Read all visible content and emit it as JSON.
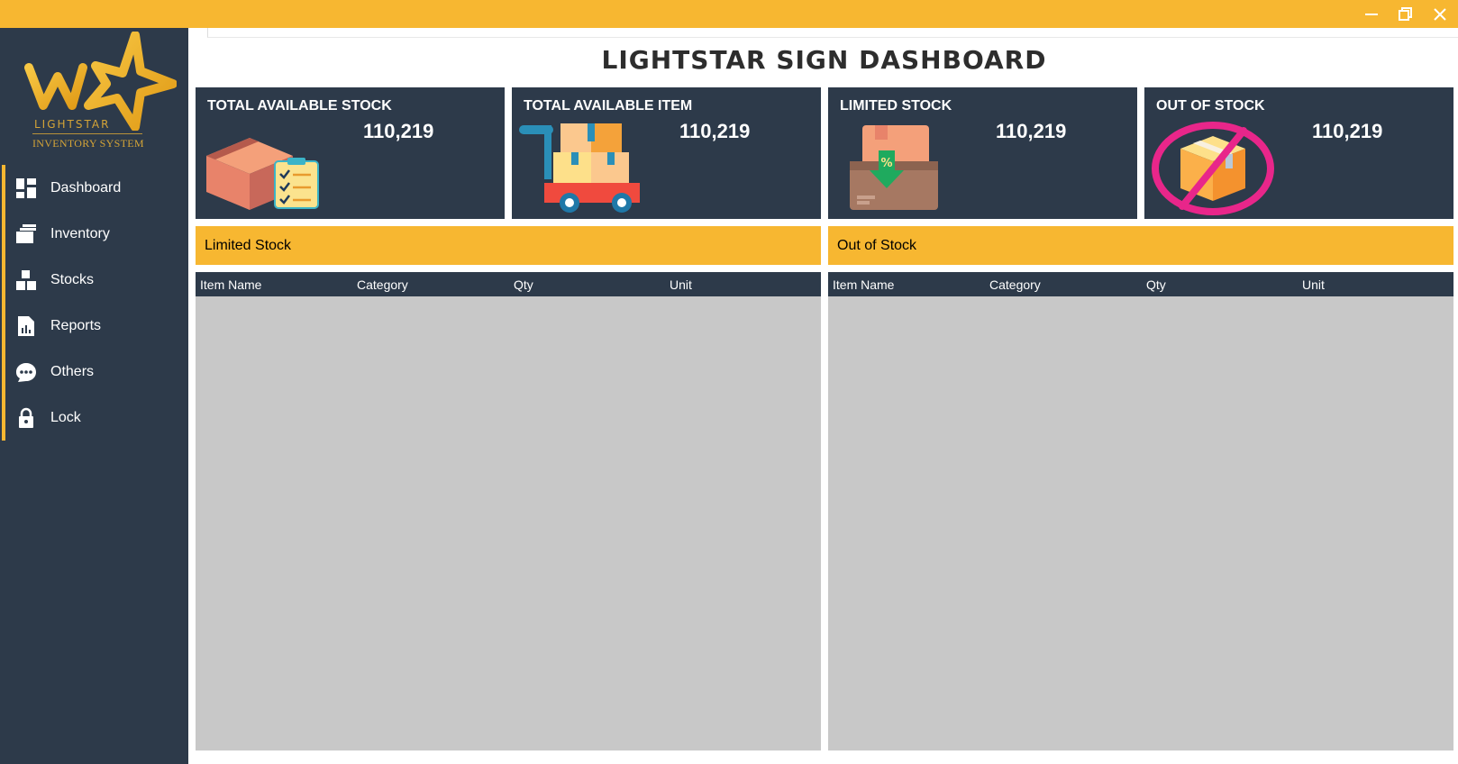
{
  "window": {
    "minimize_icon": "minimize-icon",
    "maximize_icon": "restore-icon",
    "close_icon": "close-icon",
    "accent_color": "#f7b731"
  },
  "logo": {
    "line1": "LIGHTSTAR",
    "line2": "INVENTORY SYSTEM"
  },
  "sidebar": {
    "background": "#2d3a4a",
    "items": [
      {
        "label": "Dashboard",
        "icon": "dashboard-icon"
      },
      {
        "label": "Inventory",
        "icon": "inventory-icon"
      },
      {
        "label": "Stocks",
        "icon": "stocks-icon"
      },
      {
        "label": "Reports",
        "icon": "reports-icon"
      },
      {
        "label": "Others",
        "icon": "others-icon"
      },
      {
        "label": "Lock",
        "icon": "lock-icon"
      }
    ]
  },
  "page": {
    "title": "LIGHTSTAR SIGN DASHBOARD"
  },
  "cards": [
    {
      "title": "TOTAL AVAILABLE STOCK",
      "value": "110,219",
      "icon": "box-checklist-icon"
    },
    {
      "title": "TOTAL AVAILABLE ITEM",
      "value": "110,219",
      "icon": "cart-boxes-icon"
    },
    {
      "title": "LIMITED STOCK",
      "value": "110,219",
      "icon": "box-discount-icon"
    },
    {
      "title": "OUT OF STOCK",
      "value": "110,219",
      "icon": "no-box-icon"
    }
  ],
  "panels": [
    {
      "header": "Limited Stock",
      "columns": [
        "Item Name",
        "Category",
        "Qty",
        "Unit"
      ]
    },
    {
      "header": "Out of Stock",
      "columns": [
        "Item Name",
        "Category",
        "Qty",
        "Unit"
      ]
    }
  ]
}
